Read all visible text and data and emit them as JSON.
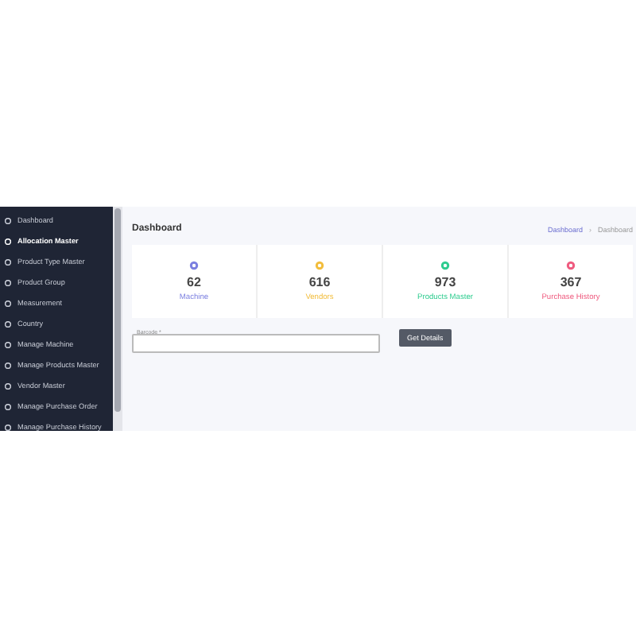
{
  "sidebar": {
    "items": [
      {
        "label": "Dashboard",
        "selected": false
      },
      {
        "label": "Allocation Master",
        "selected": true
      },
      {
        "label": "Product Type Master",
        "selected": false
      },
      {
        "label": "Product Group",
        "selected": false
      },
      {
        "label": "Measurement",
        "selected": false
      },
      {
        "label": "Country",
        "selected": false
      },
      {
        "label": "Manage Machine",
        "selected": false
      },
      {
        "label": "Manage Products Master",
        "selected": false
      },
      {
        "label": "Vendor Master",
        "selected": false
      },
      {
        "label": "Manage Purchase Order",
        "selected": false
      },
      {
        "label": "Manage Purchase History",
        "selected": false
      }
    ]
  },
  "page_title": "Dashboard",
  "breadcrumb_separator": "›",
  "breadcrumb": [
    {
      "label": "Dashboard",
      "selected": false
    },
    {
      "label": "Dashboard",
      "selected": true
    }
  ],
  "cards": [
    {
      "value": "62",
      "label": "Machine",
      "color": "#7b7fe0"
    },
    {
      "value": "616",
      "label": "Vendors",
      "color": "#f2bd3c"
    },
    {
      "value": "973",
      "label": "Products Master",
      "color": "#2ecc8f"
    },
    {
      "value": "367",
      "label": "Purchase History",
      "color": "#ef5b7f"
    }
  ],
  "barcode": {
    "label": "Barcode *"
  },
  "button": "Get Details"
}
